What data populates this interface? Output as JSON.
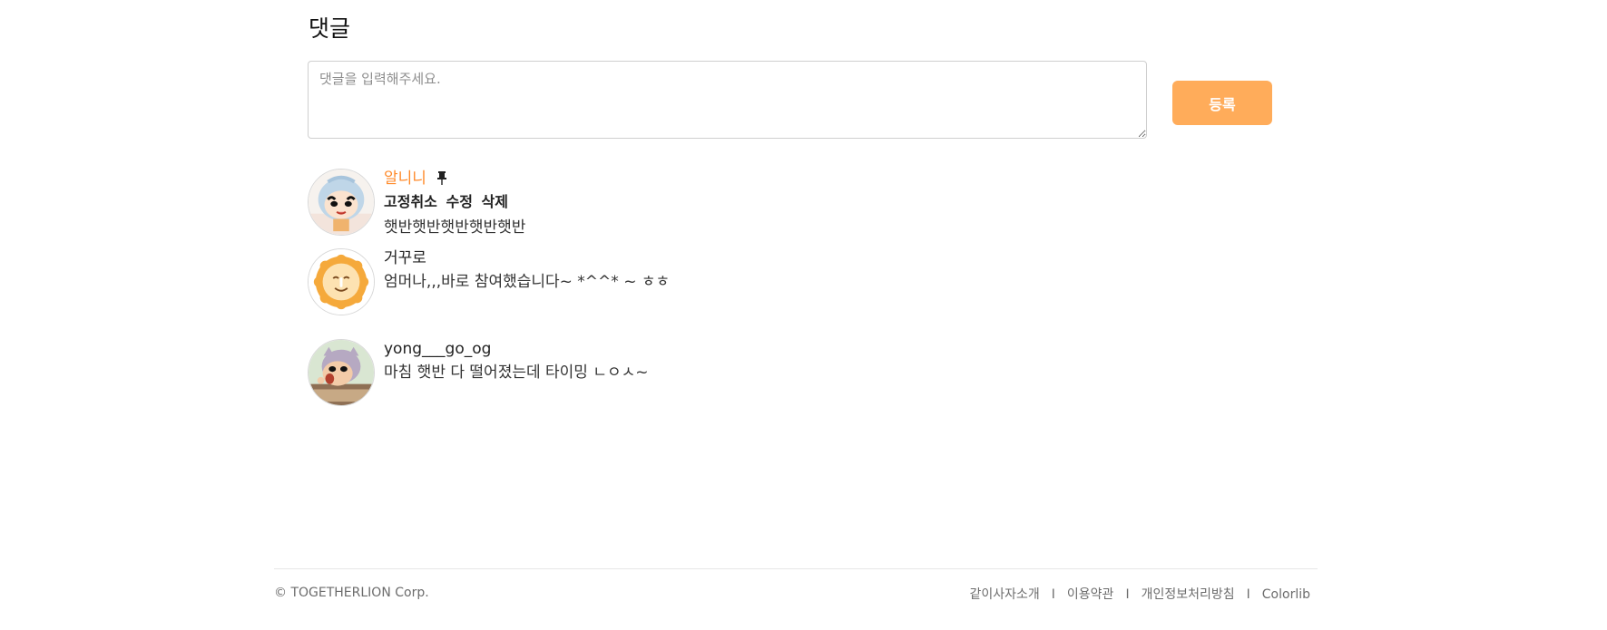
{
  "comments_section": {
    "title": "댓글",
    "input_placeholder": "댓글을 입력해주세요.",
    "submit_label": "등록"
  },
  "comments": [
    {
      "author": "알니니",
      "pinned": true,
      "actions": {
        "unpin": "고정취소",
        "edit": "수정",
        "delete": "삭제"
      },
      "text": "햇반햇반햇반햇반햇반",
      "avatar": "cartoon-boy-avatar"
    },
    {
      "author": "거꾸로",
      "pinned": false,
      "text": "엄머나,,,바로 참여했습니다~ *^^* ~ ㅎㅎ",
      "avatar": "lion-avatar"
    },
    {
      "author": "yong___go_og",
      "pinned": false,
      "text": "마침 햇반 다 떨어졌는데 타이밍 ㄴㅇㅅ~",
      "avatar": "cartoon-boy-cat-hood-avatar"
    }
  ],
  "footer": {
    "copyright": "© TOGETHERLION Corp.",
    "links": [
      "같이사자소개",
      "이용약관",
      "개인정보처리방침",
      "Colorlib"
    ],
    "separator": "I"
  },
  "colors": {
    "accent": "#ffac5a",
    "pinned_author": "#ff8a2a"
  }
}
